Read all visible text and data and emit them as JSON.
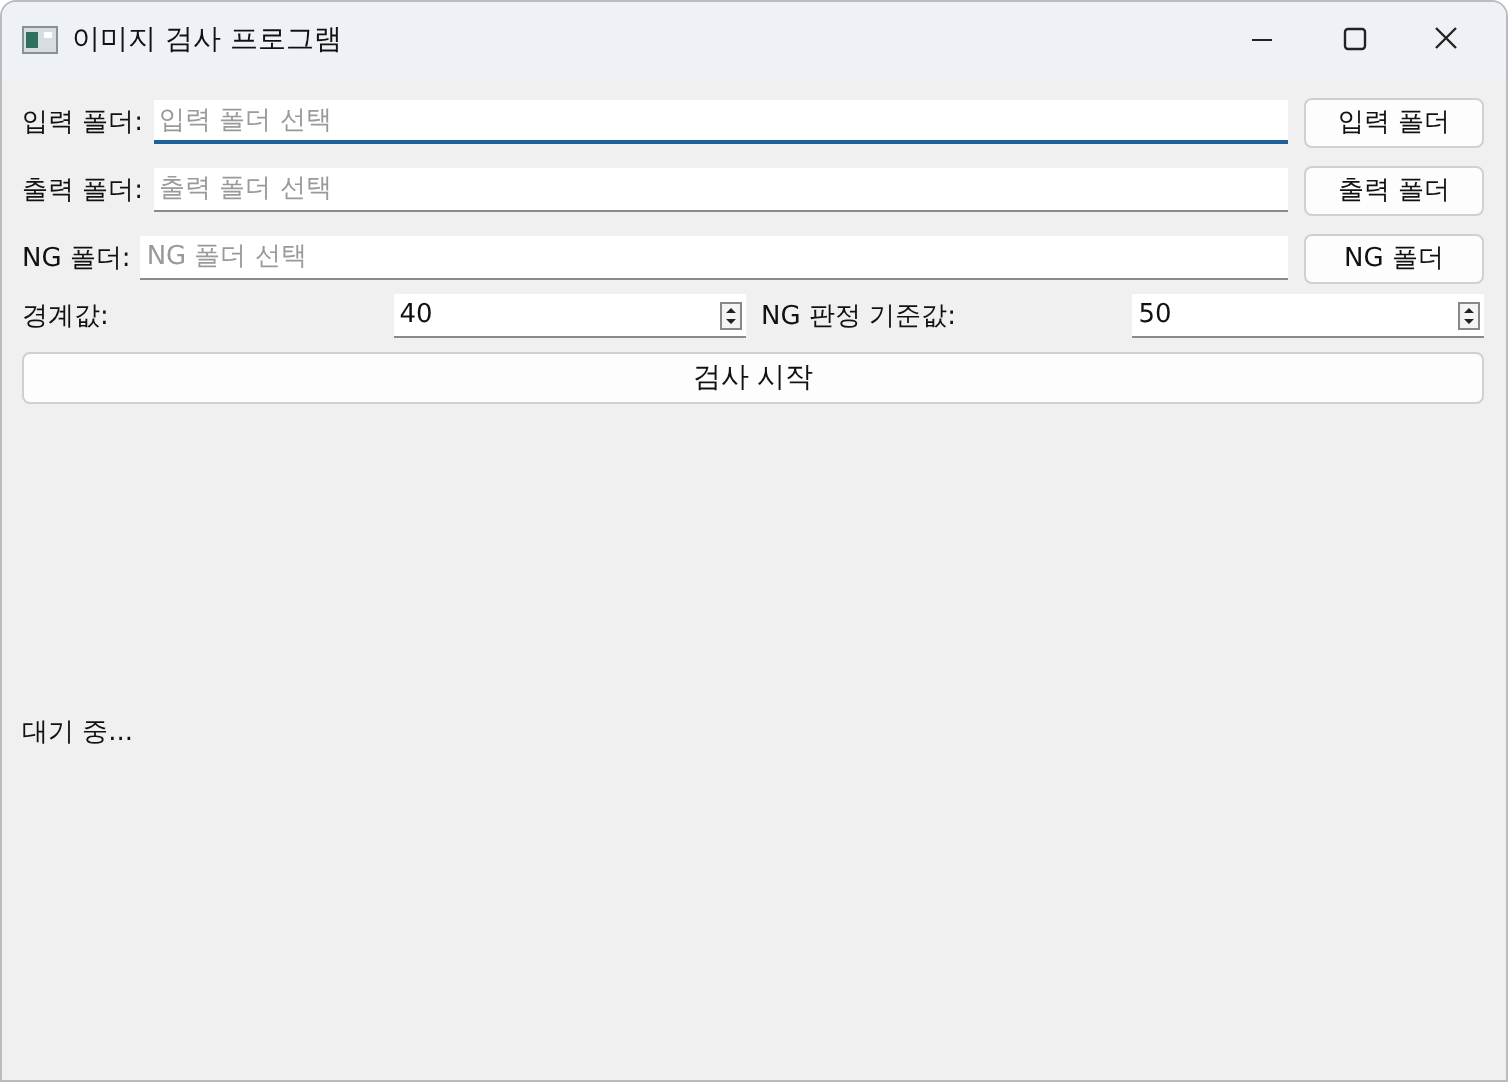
{
  "window": {
    "title": "이미지 검사 프로그램"
  },
  "folders": [
    {
      "label": "입력 폴더:",
      "placeholder": "입력 폴더 선택",
      "button": "입력 폴더",
      "focused": true
    },
    {
      "label": "출력 폴더:",
      "placeholder": "출력 폴더 선택",
      "button": "출력 폴더",
      "focused": false
    },
    {
      "label": "NG 폴더:",
      "placeholder": "NG 폴더 선택",
      "button": "NG 폴더",
      "focused": false
    }
  ],
  "spinboxes": [
    {
      "label": "경계값:",
      "value": "40"
    },
    {
      "label": "NG 판정 기준값:",
      "value": "50"
    }
  ],
  "start_button": "검사 시작",
  "status": "대기 중..."
}
